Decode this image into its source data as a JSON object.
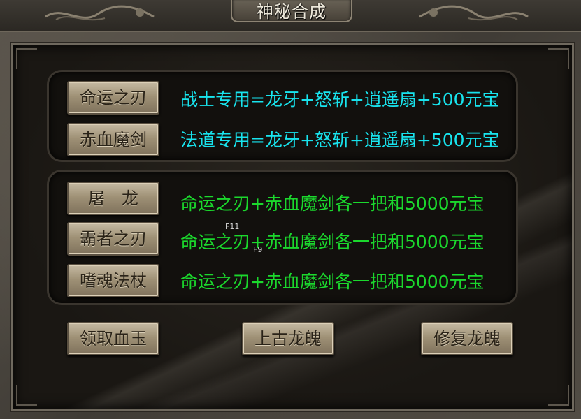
{
  "window": {
    "title": "神秘合成"
  },
  "section1": {
    "rows": [
      {
        "button": "命运之刃",
        "recipe": "战士专用=龙牙+怒斩+逍遥扇+500元宝"
      },
      {
        "button": "赤血魔剑",
        "recipe": "法道专用=龙牙+怒斩+逍遥扇+500元宝"
      }
    ]
  },
  "section2": {
    "rows": [
      {
        "button": "屠　龙",
        "recipe": "命运之刃+赤血魔剑各一把和5000元宝"
      },
      {
        "button": "霸者之刃",
        "recipe": "命运之刃+赤血魔剑各一把和5000元宝"
      },
      {
        "button": "嗜魂法杖",
        "recipe": "命运之刃+赤血魔剑各一把和5000元宝"
      }
    ]
  },
  "bottom": {
    "buttons": [
      "领取血玉",
      "上古龙魄",
      "修复龙魄"
    ]
  },
  "overlay_tags": [
    "F11",
    "F9"
  ],
  "colors": {
    "recipe_class_text": "#18e4ee",
    "recipe_upgrade_text": "#1bd82d",
    "button_text": "#2a2318"
  }
}
